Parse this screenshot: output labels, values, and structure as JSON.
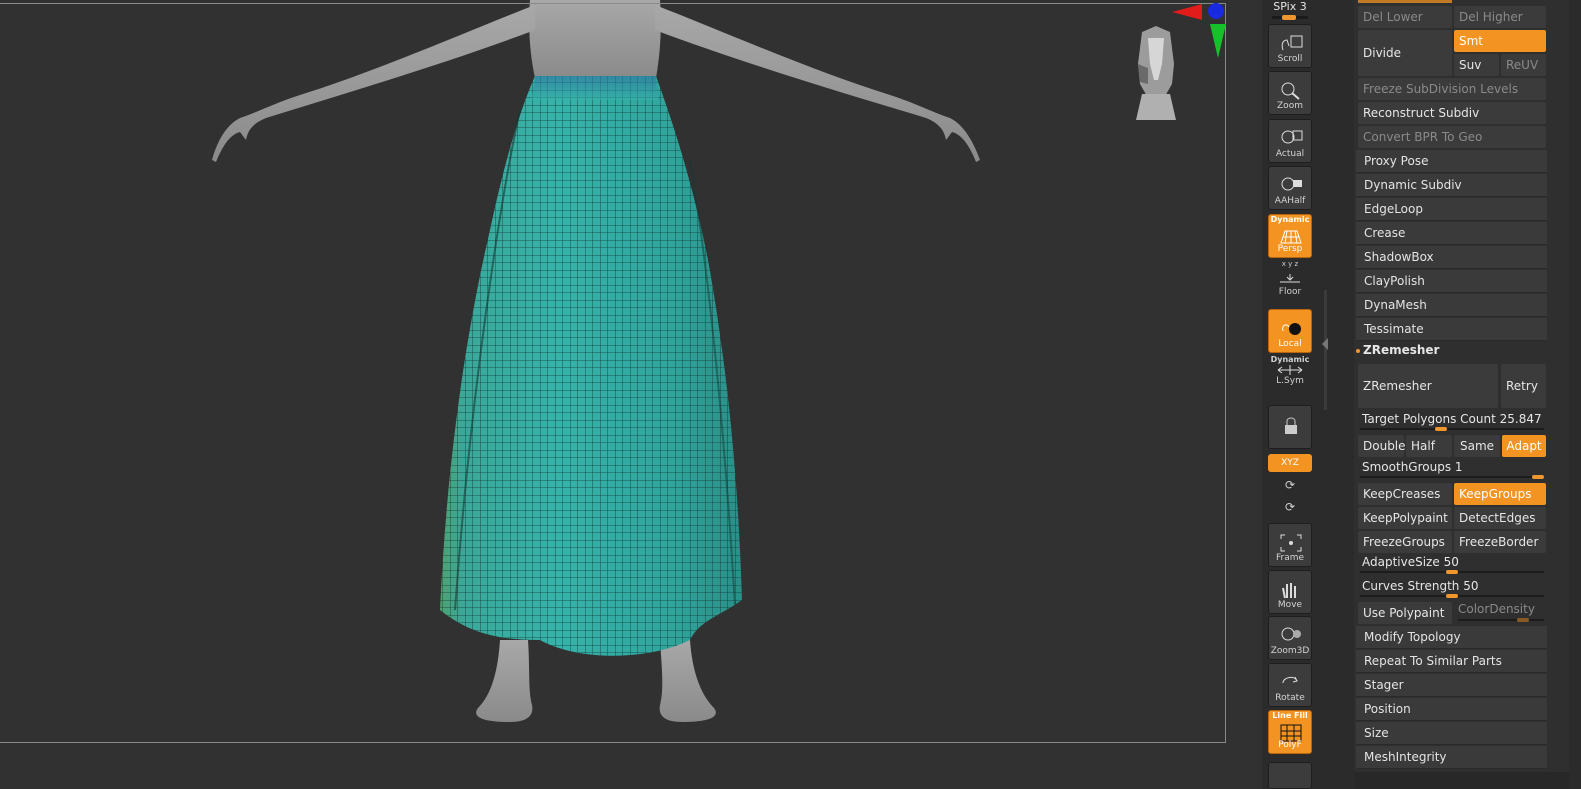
{
  "shelf": {
    "spix_label": "SPix 3",
    "buttons": [
      {
        "id": "scroll",
        "label": "Scroll",
        "icon": "scroll-icon",
        "active": false
      },
      {
        "id": "zoom",
        "label": "Zoom",
        "icon": "zoom-icon",
        "active": false
      },
      {
        "id": "actual",
        "label": "Actual",
        "icon": "actual-icon",
        "active": false
      },
      {
        "id": "aahalf",
        "label": "AAHalf",
        "icon": "aahalf-icon",
        "active": false
      },
      {
        "id": "persp",
        "label": "Persp",
        "top": "Dynamic",
        "icon": "perspective-icon",
        "active": true
      },
      {
        "id": "floor",
        "label": "Floor",
        "icon": "floor-icon",
        "active": false
      },
      {
        "id": "local",
        "label": "Local",
        "icon": "local-icon",
        "active": true
      },
      {
        "id": "lsym",
        "label": "L.Sym",
        "top": "Dynamic",
        "icon": "symmetry-icon",
        "active": false
      },
      {
        "id": "transp",
        "label": "",
        "icon": "camera-lock-icon",
        "active": false
      },
      {
        "id": "frame",
        "label": "Frame",
        "icon": "frame-icon",
        "active": false
      },
      {
        "id": "move",
        "label": "Move",
        "icon": "move-hand-icon",
        "active": false
      },
      {
        "id": "zoom3d",
        "label": "Zoom3D",
        "icon": "zoom3d-icon",
        "active": false
      },
      {
        "id": "rotate",
        "label": "Rotate",
        "icon": "rotate-icon",
        "active": false
      },
      {
        "id": "polyf",
        "label": "PolyF",
        "top": "Line Fill",
        "icon": "polyframe-icon",
        "active": true
      }
    ],
    "xyz_label": "XYZ",
    "axis_label": "x y z"
  },
  "panel": {
    "del_lower": "Del Lower",
    "del_higher": "Del Higher",
    "divide": "Divide",
    "smt": "Smt",
    "suv": "Suv",
    "reuv": "ReUV",
    "freeze_subdiv": "Freeze SubDivision Levels",
    "reconstruct_subdiv": "Reconstruct Subdiv",
    "convert_bpr": "Convert BPR To Geo",
    "sections_top": [
      "Proxy Pose",
      "Dynamic Subdiv",
      "EdgeLoop",
      "Crease",
      "ShadowBox",
      "ClayPolish",
      "DynaMesh",
      "Tessimate"
    ],
    "zremesher_header": "ZRemesher",
    "zremesher_btn": "ZRemesher",
    "retry_btn": "Retry",
    "target_label": "Target Polygons Count",
    "target_value": "25.847",
    "target_level": 0.44,
    "double": "Double",
    "half": "Half",
    "same": "Same",
    "adapt": "Adapt",
    "smoothgroups_label": "SmoothGroups",
    "smoothgroups_value": "1",
    "smoothgroups_level": 1.0,
    "keepcreases": "KeepCreases",
    "keepgroups": "KeepGroups",
    "keeppolypaint": "KeepPolypaint",
    "detectedges": "DetectEdges",
    "freezegroups": "FreezeGroups",
    "freezeborder": "FreezeBorder",
    "adaptivesize_label": "AdaptiveSize",
    "adaptivesize_value": "50",
    "adaptivesize_level": 0.5,
    "curves_label": "Curves Strength",
    "curves_value": "50",
    "curves_level": 0.5,
    "usepolypaint": "Use Polypaint",
    "colordensity": "ColorDensity",
    "colordensity_level": 0.75,
    "sections_bottom": [
      "Modify Topology",
      "Repeat To Similar Parts",
      "Stager",
      "Position",
      "Size",
      "MeshIntegrity"
    ]
  },
  "colors": {
    "accent": "#f39322",
    "viewport_bg": "#313131",
    "skirt": "#2fa59a",
    "skin": "#9a9a9a"
  }
}
